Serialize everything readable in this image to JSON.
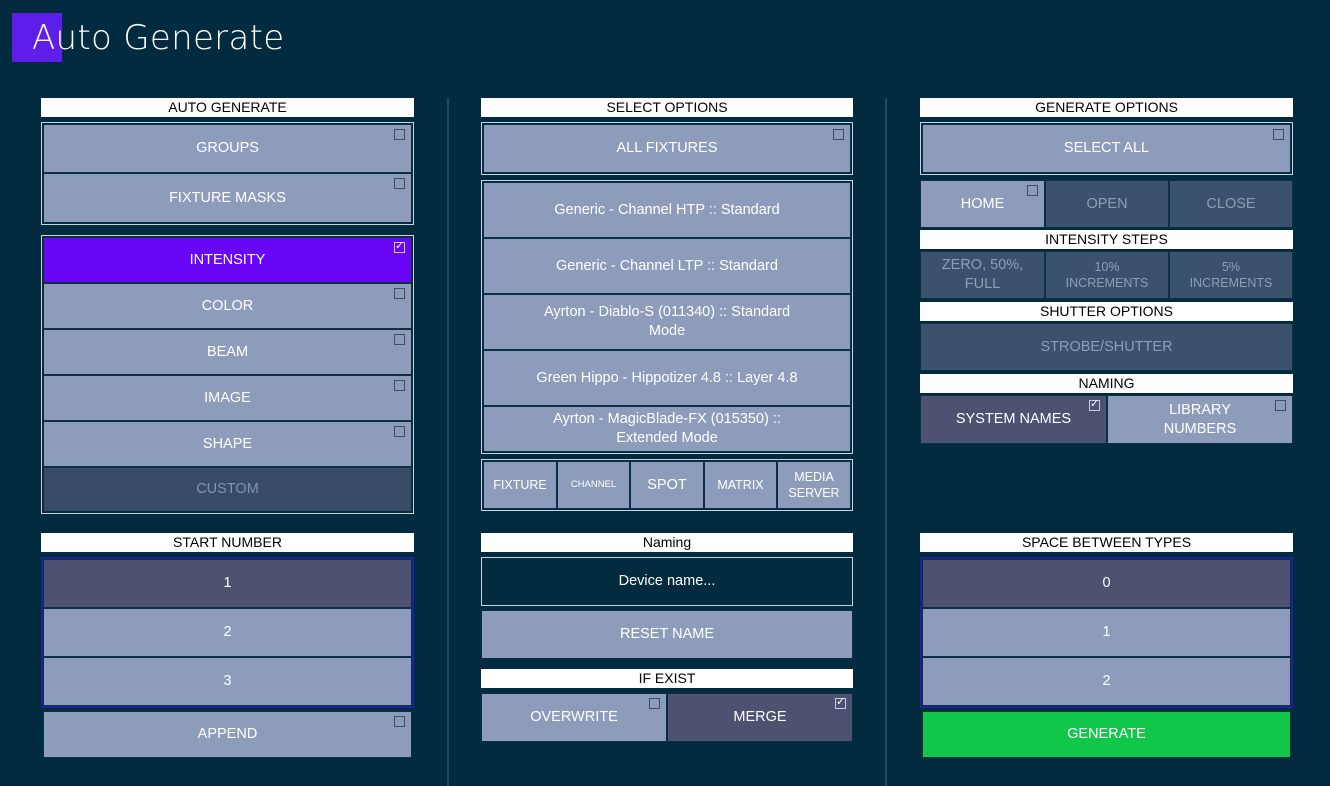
{
  "title": "Auto Generate",
  "left": {
    "header": "AUTO GENERATE",
    "groups": "GROUPS",
    "fixture_masks": "FIXTURE MASKS",
    "attributes": [
      {
        "label": "INTENSITY",
        "checked": true
      },
      {
        "label": "COLOR",
        "checked": false
      },
      {
        "label": "BEAM",
        "checked": false
      },
      {
        "label": "IMAGE",
        "checked": false
      },
      {
        "label": "SHAPE",
        "checked": false
      }
    ],
    "custom": "CUSTOM",
    "start_header": "START NUMBER",
    "start_values": [
      "1",
      "2",
      "3"
    ],
    "append": "APPEND"
  },
  "middle": {
    "header": "SELECT OPTIONS",
    "all_fixtures": "ALL FIXTURES",
    "fixtures": [
      "Generic - Channel HTP :: Standard",
      "Generic - Channel LTP :: Standard",
      "Ayrton - Diablo-S (011340) :: Standard Mode",
      "Green Hippo - Hippotizer 4.8 :: Layer 4.8",
      "Ayrton - MagicBlade-FX (015350) :: Extended Mode"
    ],
    "types": [
      "FIXTURE",
      "CHANNEL",
      "SPOT",
      "MATRIX",
      "MEDIA SERVER"
    ],
    "naming_header": "Naming",
    "device_name_placeholder": "Device name...",
    "reset_name": "RESET NAME",
    "if_exist_header": "IF EXIST",
    "overwrite": "OVERWRITE",
    "merge": "MERGE"
  },
  "right": {
    "header": "GENERATE OPTIONS",
    "select_all": "SELECT ALL",
    "home": "HOME",
    "open": "OPEN",
    "close": "CLOSE",
    "intensity_steps_header": "INTENSITY STEPS",
    "intensity_steps": [
      "ZERO, 50%, FULL",
      "10% INCREMENTS",
      "5% INCREMENTS"
    ],
    "shutter_header": "SHUTTER OPTIONS",
    "strobe_shutter": "STROBE/SHUTTER",
    "naming_header": "NAMING",
    "system_names": "SYSTEM NAMES",
    "library_numbers": "LIBRARY NUMBERS",
    "space_header": "SPACE BETWEEN TYPES",
    "space_values": [
      "0",
      "1",
      "2"
    ],
    "generate": "GENERATE"
  },
  "colors": {
    "background": "#022b3f",
    "button": "#8e9cbc",
    "selected": "#4c5270",
    "accent_purple": "#6a06f6",
    "generate_green": "#10c74a"
  }
}
